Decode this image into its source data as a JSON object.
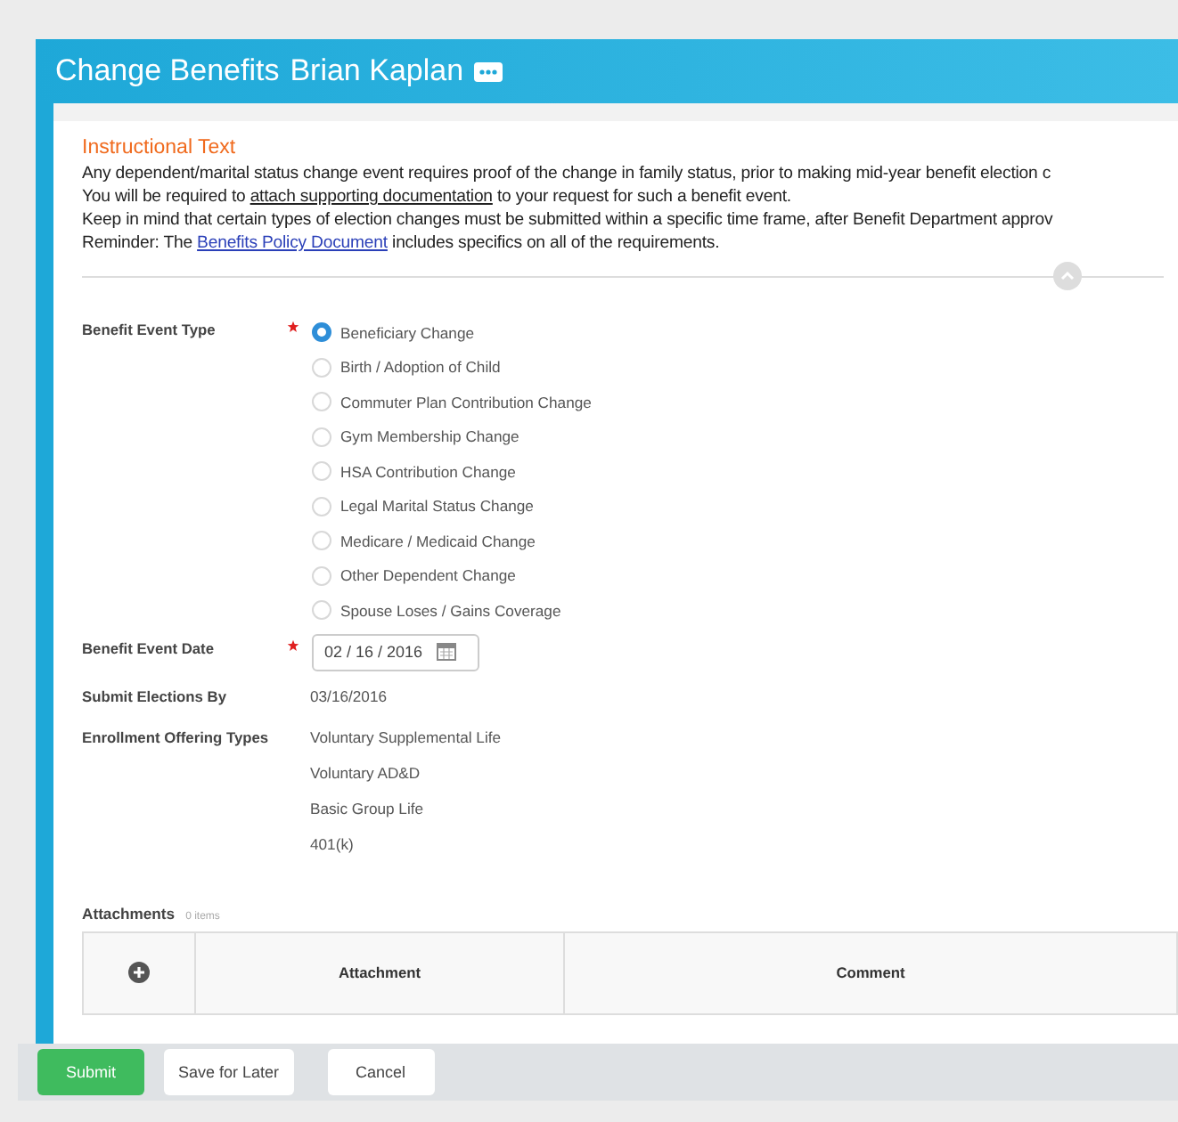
{
  "header": {
    "title": "Change Benefits",
    "person": "Brian Kaplan"
  },
  "instructions": {
    "heading": "Instructional Text",
    "lines": [
      {
        "kind": "plain",
        "text": "Any dependent/marital status change event requires proof of the change in family status, prior to making mid-year benefit election c"
      },
      {
        "kind": "underline",
        "before": "You will be required to ",
        "link": "attach supporting documentation",
        "after": " to your request for such a benefit event."
      },
      {
        "kind": "plain",
        "text": "Keep in mind that certain types of election changes must be submitted within a specific time frame, after Benefit Department approv"
      },
      {
        "kind": "link",
        "before": "Reminder: The ",
        "link": "Benefits Policy Document",
        "after": " includes specifics on all of the requirements."
      }
    ]
  },
  "event_type": {
    "label": "Benefit Event Type",
    "required": true,
    "options": [
      {
        "label": "Beneficiary Change",
        "selected": true
      },
      {
        "label": "Birth / Adoption of Child",
        "selected": false
      },
      {
        "label": "Commuter Plan Contribution Change",
        "selected": false
      },
      {
        "label": "Gym Membership Change",
        "selected": false
      },
      {
        "label": "HSA Contribution Change",
        "selected": false
      },
      {
        "label": "Legal Marital Status Change",
        "selected": false
      },
      {
        "label": "Medicare / Medicaid Change",
        "selected": false
      },
      {
        "label": "Other Dependent Change",
        "selected": false
      },
      {
        "label": "Spouse Loses / Gains Coverage",
        "selected": false
      }
    ]
  },
  "event_date": {
    "label": "Benefit Event Date",
    "required": true,
    "value": "02 / 16 / 2016"
  },
  "submit_by": {
    "label": "Submit Elections By",
    "value": "03/16/2016"
  },
  "offering_types": {
    "label": "Enrollment Offering Types",
    "values": [
      "Voluntary Supplemental Life",
      "Voluntary AD&D",
      "Basic Group Life",
      "401(k)"
    ]
  },
  "attachments": {
    "title": "Attachments",
    "count": "0 items",
    "columns": [
      "Attachment",
      "Comment"
    ]
  },
  "buttons": [
    {
      "label": "Submit",
      "kind": "primary"
    },
    {
      "label": "Save for Later",
      "kind": "secondary"
    },
    {
      "label": "Cancel",
      "kind": "secondary"
    }
  ]
}
